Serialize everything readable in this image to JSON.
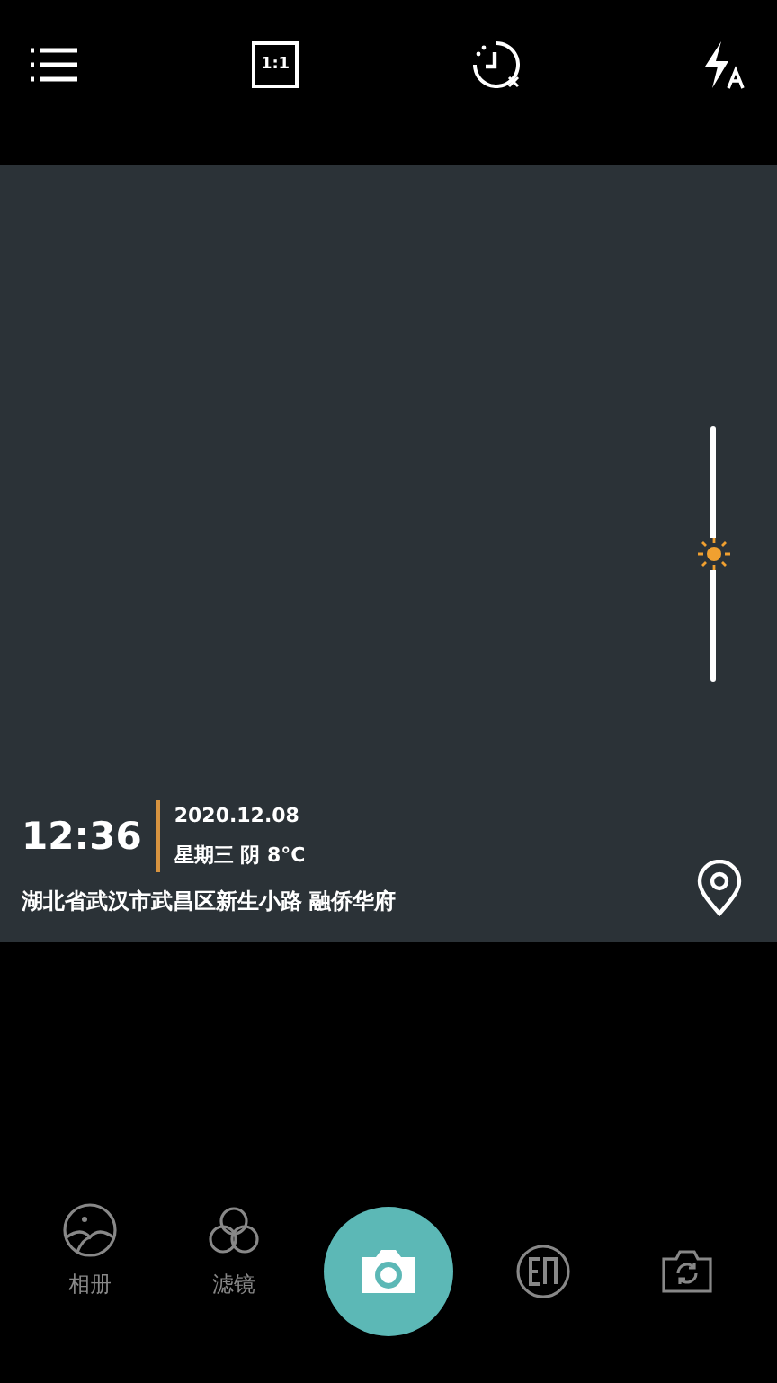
{
  "top_bar": {
    "ratio": "1:1"
  },
  "viewfinder": {
    "exposure": {
      "level": 0.5
    },
    "time": "12:36",
    "date": "2020.12.08",
    "weather": "星期三 阴 8°C",
    "address": "湖北省武汉市武昌区新生小路 融侨华府"
  },
  "bottom_bar": {
    "items": [
      {
        "kind": "album",
        "label": "相册"
      },
      {
        "kind": "filter",
        "label": "滤镜"
      },
      {
        "kind": "shutter"
      },
      {
        "kind": "edit"
      },
      {
        "kind": "switch"
      }
    ]
  }
}
